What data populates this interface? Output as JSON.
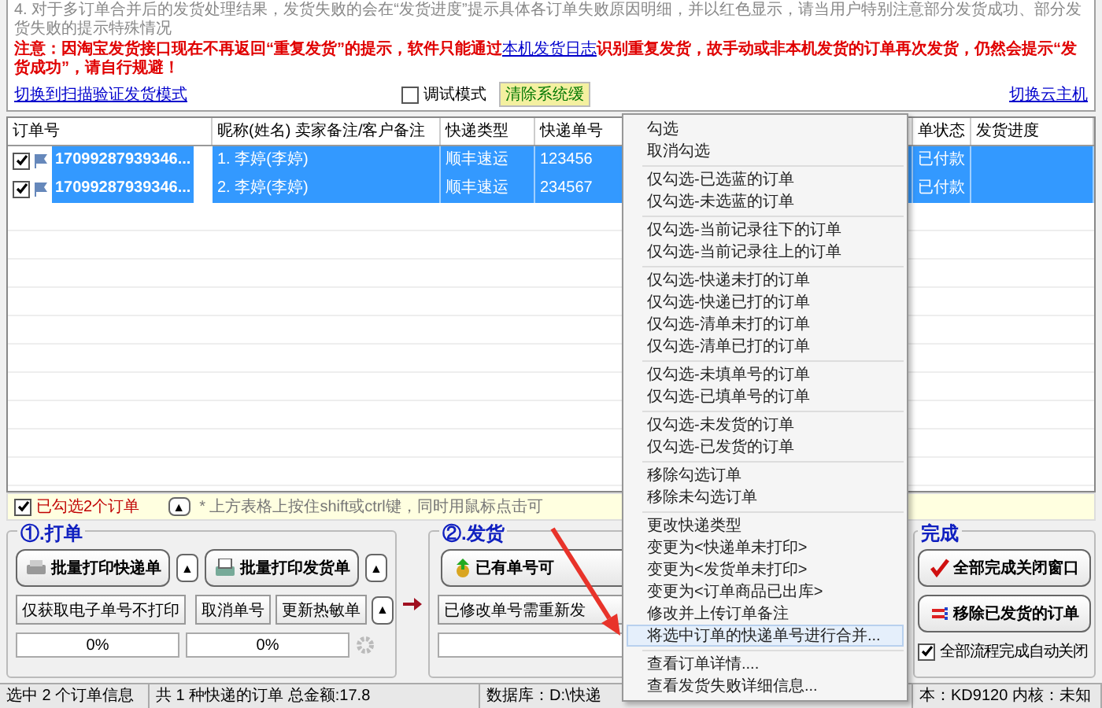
{
  "notice": {
    "lines": [
      "4. 对于多订单合并后的发货处理结果，发货失败的会在“发货进度”提示具体各订单失败原因明细，并以红色显示，请当用户特别注意部分发货成功、部分发货失败的提示特殊情况"
    ],
    "warning": {
      "before": "注意：因淘宝发货接口现在不再返回“重复发货”的提示，软件只能通过",
      "link": "本机发货日志",
      "after": "识别重复发货，故手动或非本机发货的订单再次发货，仍然会提示“发货成功”，请自行规避！"
    },
    "scan_mode_link": "切换到扫描验证发货模式",
    "debug_mode": {
      "label": "调试模式",
      "checked": false
    },
    "clear_cache_button": "清除系统缓",
    "cloud_link": "切换云主机"
  },
  "table": {
    "columns": [
      "订单号",
      "昵称(姓名) 卖家备注/客户备注",
      "快递类型",
      "快递单号",
      "单状态",
      "发货进度"
    ],
    "rows": [
      {
        "checked": true,
        "selected": true,
        "cells": [
          "17099287939346...",
          "1. 李婷(李婷)",
          "顺丰速运",
          "123456",
          "已付款"
        ]
      },
      {
        "checked": true,
        "selected": true,
        "cells": [
          "17099287939346...",
          "2. 李婷(李婷)",
          "顺丰速运",
          "234567",
          "已付款"
        ]
      }
    ]
  },
  "selection_bar": {
    "checked": true,
    "label": "已勾选2个订单",
    "expand": "▲",
    "hint": "* 上方表格上按住shift或ctrl键，同时用鼠标点击可"
  },
  "print_group": {
    "title": "①.打单",
    "print_express": "批量打印快递单",
    "print_invoice": "批量打印发货单",
    "more": "▲",
    "get_numbers": "仅获取电子单号不打印",
    "cancel_numbers": "取消单号",
    "update_thermal": "更新热敏单",
    "progress": [
      {
        "text": "0%",
        "level": 0
      },
      {
        "text": "0%",
        "level": 0
      }
    ]
  },
  "ship_group": {
    "title": "②.发货",
    "ship_button": "已有单号可",
    "reship_button": "已修改单号需重新发",
    "progress": {
      "level": 0
    }
  },
  "finish_group": {
    "title": "完成",
    "close_button": "全部完成关闭窗口",
    "remove_button": "移除已发货的订单",
    "auto_close": {
      "label": "全部流程完成自动关闭",
      "checked": true
    }
  },
  "status_bar": [
    "选中 2 个订单信息",
    "共 1 种快递的订单  总金额:17.8",
    "数据库：D:\\快递",
    "本：KD9120 内核：未知"
  ],
  "context_menu": {
    "groups": [
      [
        {
          "label": "勾选",
          "selected": false
        },
        {
          "label": "取消勾选",
          "selected": false
        }
      ],
      [
        {
          "label": "仅勾选-已选蓝的订单",
          "selected": false
        },
        {
          "label": "仅勾选-未选蓝的订单",
          "selected": false
        }
      ],
      [
        {
          "label": "仅勾选-当前记录往下的订单",
          "selected": false
        },
        {
          "label": "仅勾选-当前记录往上的订单",
          "selected": false
        }
      ],
      [
        {
          "label": "仅勾选-快递未打的订单",
          "selected": false
        },
        {
          "label": "仅勾选-快递已打的订单",
          "selected": false
        },
        {
          "label": "仅勾选-清单未打的订单",
          "selected": false
        },
        {
          "label": "仅勾选-清单已打的订单",
          "selected": false
        }
      ],
      [
        {
          "label": "仅勾选-未填单号的订单",
          "selected": false
        },
        {
          "label": "仅勾选-已填单号的订单",
          "selected": false
        }
      ],
      [
        {
          "label": "仅勾选-未发货的订单",
          "selected": false
        },
        {
          "label": "仅勾选-已发货的订单",
          "selected": false
        }
      ],
      [
        {
          "label": "移除勾选订单",
          "selected": false
        },
        {
          "label": "移除未勾选订单",
          "selected": false
        }
      ],
      [
        {
          "label": "更改快递类型",
          "selected": false
        },
        {
          "label": "变更为<快递单未打印>",
          "selected": false
        },
        {
          "label": "变更为<发货单未打印>",
          "selected": false
        },
        {
          "label": "变更为<订单商品已出库>",
          "selected": false
        },
        {
          "label": "修改并上传订单备注",
          "selected": false
        },
        {
          "label": "将选中订单的快递单号进行合并...",
          "selected": true
        }
      ],
      [
        {
          "label": "查看订单详情....",
          "selected": false
        },
        {
          "label": "查看发货失败详细信息...",
          "selected": false
        }
      ]
    ]
  }
}
